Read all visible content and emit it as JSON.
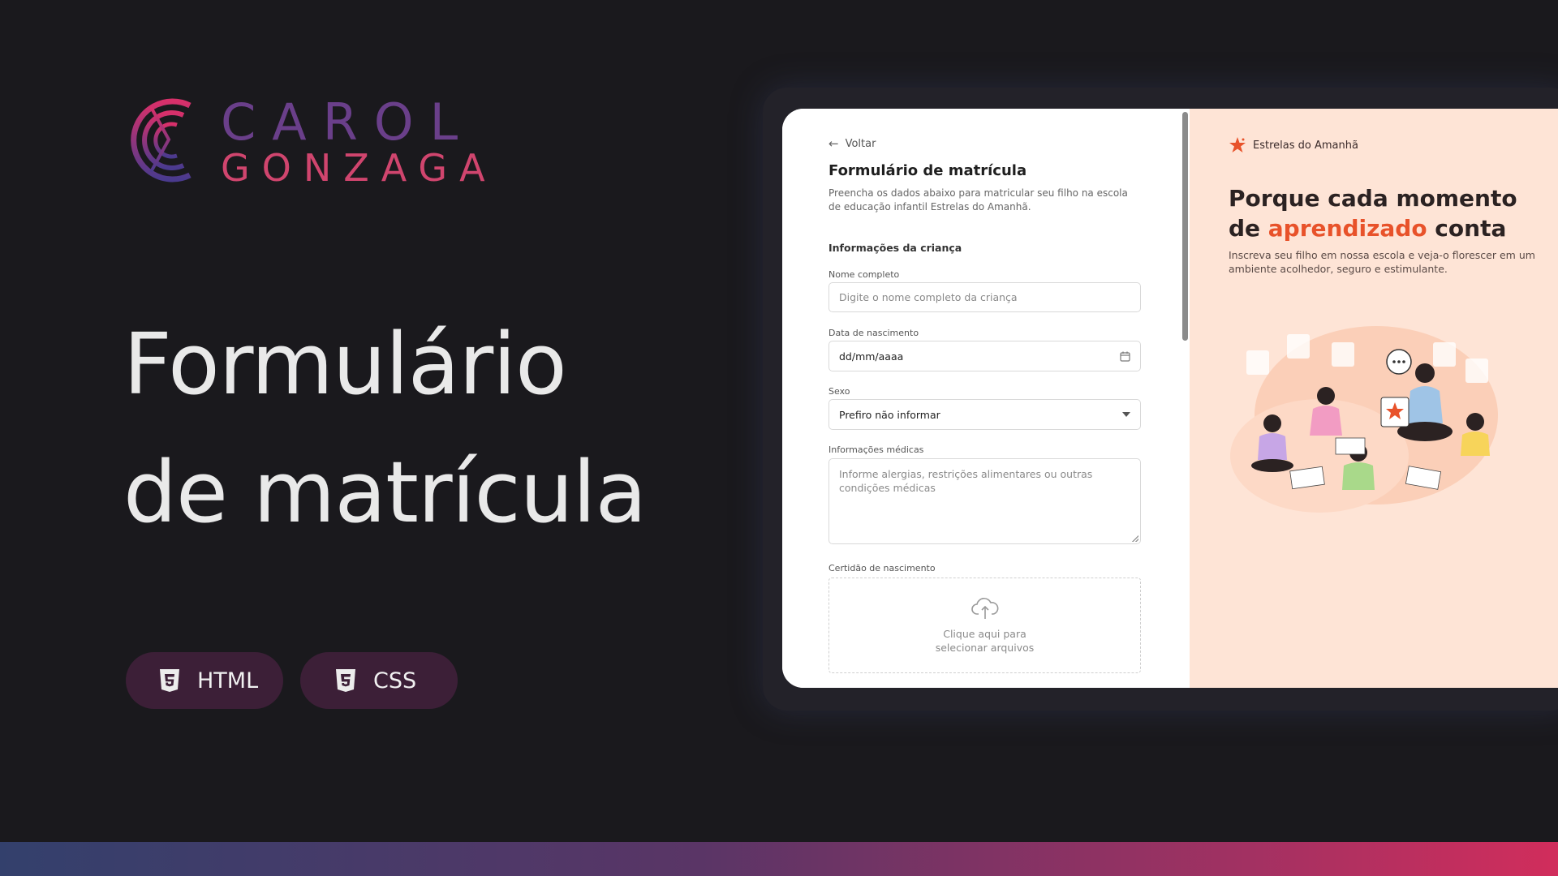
{
  "brand": {
    "line1": "CAROL",
    "line2": "GONZAGA"
  },
  "hero": {
    "title_line1": "Formulário",
    "title_line2": "de matrícula"
  },
  "badges": [
    {
      "label": "HTML",
      "icon": "html5-icon"
    },
    {
      "label": "CSS",
      "icon": "css3-icon"
    }
  ],
  "colors": {
    "background": "#1a191d",
    "badge_bg": "#3c1f37",
    "brand_purple": "#6a3f8a",
    "brand_pink": "#d0456e",
    "promo_bg": "#fee4d6",
    "accent_orange": "#e8522a"
  },
  "form": {
    "back_label": "Voltar",
    "title": "Formulário de matrícula",
    "description": "Preencha os dados abaixo para matricular seu filho na escola de educação infantil Estrelas do Amanhã.",
    "section_title": "Informações da criança",
    "fields": {
      "name_label": "Nome completo",
      "name_placeholder": "Digite o nome completo da criança",
      "birth_label": "Data de nascimento",
      "birth_value": "dd/mm/aaaa",
      "sex_label": "Sexo",
      "sex_value": "Prefiro não informar",
      "medical_label": "Informações médicas",
      "medical_placeholder": "Informe alergias, restrições alimentares ou outras condições médicas",
      "certificate_label": "Certidão de nascimento",
      "upload_line1": "Clique aqui para",
      "upload_line2": "selecionar arquivos"
    }
  },
  "promo": {
    "brand_name": "Estrelas do Amanhã",
    "title_part1": "Porque cada momento de ",
    "title_accent": "aprendizado",
    "title_part2": " conta",
    "text": "Inscreva seu filho em nossa escola e veja-o florescer em um ambiente acolhedor, seguro e estimulante."
  }
}
